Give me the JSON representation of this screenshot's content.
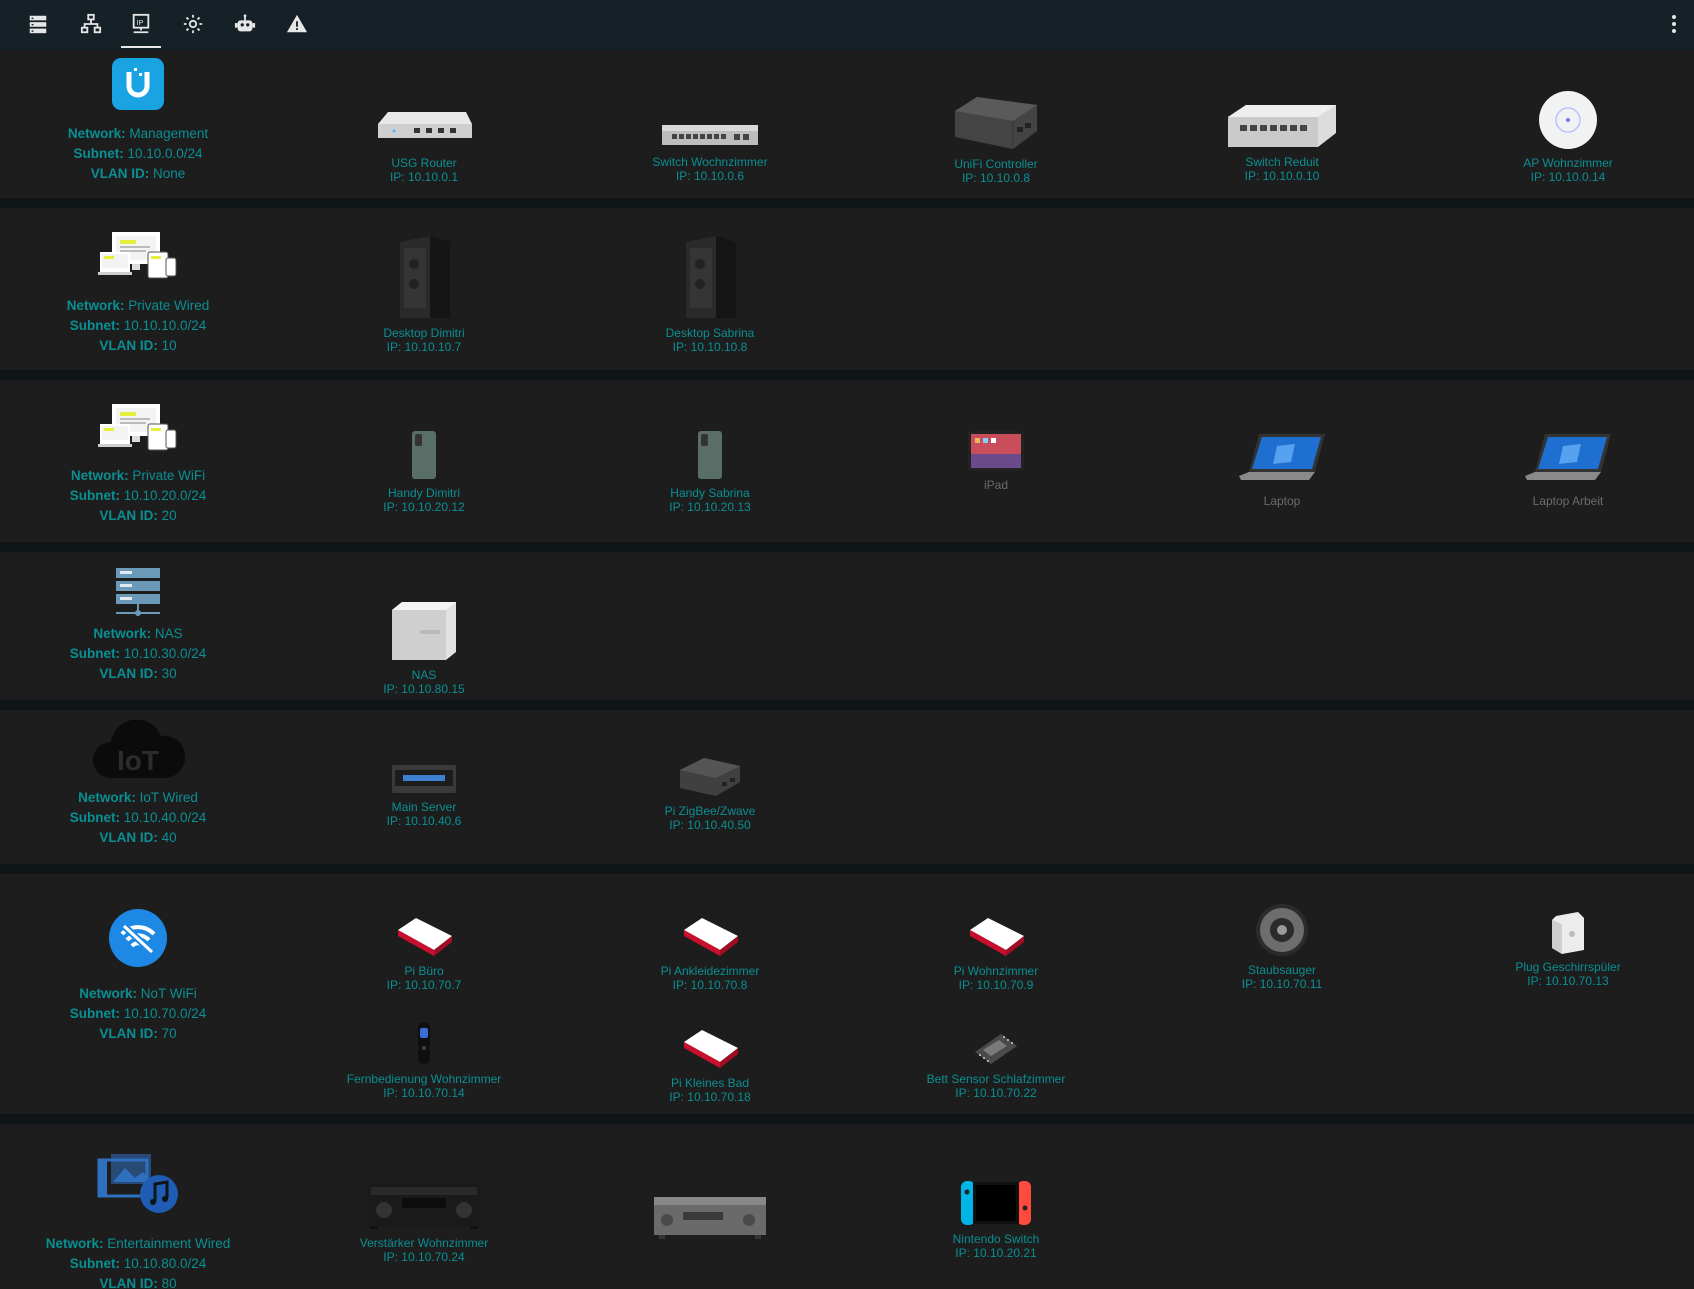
{
  "toolbar": {
    "icons": [
      "server-list-icon",
      "network-topology-icon",
      "ip-devices-icon",
      "settings-gear-icon",
      "robot-icon",
      "warning-icon"
    ],
    "active_index": 2,
    "menu_icon": "more-vertical-icon"
  },
  "labels": {
    "network": "Network:",
    "subnet": "Subnet:",
    "vlan": "VLAN ID:"
  },
  "networks": [
    {
      "name": "Management",
      "subnet": "10.10.0.0/24",
      "vlan": "None",
      "icon": "unifi-logo-icon",
      "devices": [
        {
          "name": "USG Router",
          "ip": "IP: 10.10.0.1"
        },
        {
          "name": "Switch Wochnzimmer",
          "ip": "IP: 10.10.0.6"
        },
        {
          "name": "UniFi Controller",
          "ip": "IP: 10.10.0.8"
        },
        {
          "name": "Switch Reduit",
          "ip": "IP: 10.10.0.10"
        },
        {
          "name": "AP Wohnzimmer",
          "ip": "IP: 10.10.0.14"
        }
      ]
    },
    {
      "name": "Private Wired",
      "subnet": "10.10.10.0/24",
      "vlan": "10",
      "icon": "devices-icon",
      "devices": [
        {
          "name": "Desktop Dimitri",
          "ip": "IP: 10.10.10.7"
        },
        {
          "name": "Desktop Sabrina",
          "ip": "IP: 10.10.10.8"
        }
      ]
    },
    {
      "name": "Private WiFi",
      "subnet": "10.10.20.0/24",
      "vlan": "20",
      "icon": "devices-icon",
      "devices": [
        {
          "name": "Handy Dimitri",
          "ip": "IP: 10.10.20.12"
        },
        {
          "name": "Handy Sabrina",
          "ip": "IP: 10.10.20.13"
        },
        {
          "name": "iPad",
          "ip": ""
        },
        {
          "name": "Laptop",
          "ip": ""
        },
        {
          "name": "Laptop Arbeit",
          "ip": ""
        }
      ]
    },
    {
      "name": "NAS",
      "subnet": "10.10.30.0/24",
      "vlan": "30",
      "icon": "server-icon",
      "devices": [
        {
          "name": "NAS",
          "ip": "IP: 10.10.80.15"
        }
      ]
    },
    {
      "name": "IoT Wired",
      "subnet": "10.10.40.0/24",
      "vlan": "40",
      "icon": "iot-cloud-icon",
      "iot_text": "IoT",
      "devices": [
        {
          "name": "Main Server",
          "ip": "IP: 10.10.40.6"
        },
        {
          "name": "Pi ZigBee/Zwave",
          "ip": "IP: 10.10.40.50"
        }
      ]
    },
    {
      "name": "NoT WiFi",
      "subnet": "10.10.70.0/24",
      "vlan": "70",
      "icon": "wifi-off-icon",
      "devices": [
        {
          "name": "Pi Büro",
          "ip": "IP: 10.10.70.7"
        },
        {
          "name": "Pi Ankleidezimmer",
          "ip": "IP: 10.10.70.8"
        },
        {
          "name": "Pi Wohnzimmer",
          "ip": "IP: 10.10.70.9"
        },
        {
          "name": "Staubsauger",
          "ip": "IP: 10.10.70.11"
        },
        {
          "name": "Plug Geschirrspüler",
          "ip": "IP: 10.10.70.13"
        },
        {
          "name": "Fernbedienung Wohnzimmer",
          "ip": "IP: 10.10.70.14"
        },
        {
          "name": "Pi Kleines Bad",
          "ip": "IP: 10.10.70.18"
        },
        {
          "name": "Bett Sensor Schlafzimmer",
          "ip": "IP: 10.10.70.22"
        }
      ]
    },
    {
      "name": "Entertainment Wired",
      "subnet": "10.10.80.0/24",
      "vlan": "80",
      "icon": "media-icon",
      "devices": [
        {
          "name": "Verstärker Wohnzimmer",
          "ip": "IP: 10.10.70.24"
        },
        {
          "name": "",
          "ip": ""
        },
        {
          "name": "Nintendo Switch",
          "ip": "IP: 10.10.20.21"
        }
      ]
    }
  ],
  "colors": {
    "accent": "#0a8f93",
    "background": "#1d1d1d",
    "separator": "#0f1416",
    "toolbar": "#152027",
    "offline": "#6b6b6b"
  }
}
